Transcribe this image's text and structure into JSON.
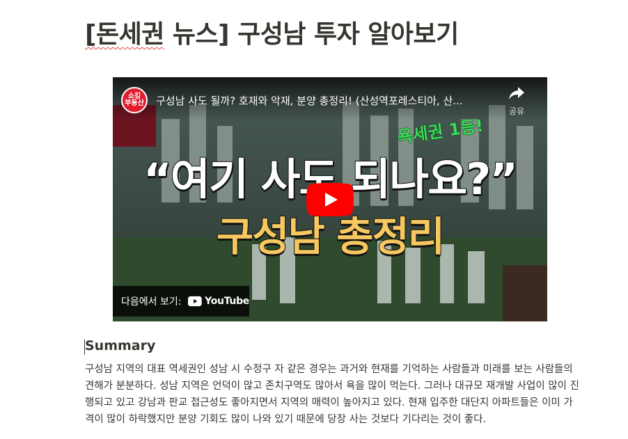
{
  "page": {
    "title": "[돈세권 뉴스] 구성남 투자 알아보기",
    "title_prefix": "[돈세권",
    "title_rest": " 뉴스] 구성남 투자 알아보기"
  },
  "video": {
    "channel_logo_text": "쇼킹\n부동산",
    "title": "구성남 사도 될까? 호재와 악재, 분양 총정리! (산성역포레스티아, 산...",
    "share_label": "공유",
    "thumbnail_badge": "욕세권 1등!",
    "thumbnail_headline": "“여기 사도 되나요?”",
    "thumbnail_subhead": "구성남 총정리",
    "watch_on_label": "다음에서 보기:",
    "youtube_label": "YouTube"
  },
  "summary": {
    "heading": "Summary",
    "body": "구성남 지역의 대표 역세권인 성남 시 수정구 자 같은 경우는 과거와 현재를 기억하는 사람들과 미래를 보는 사람들의 견해가 분분하다. 성남 지역은 언덕이 많고 존치구역도 많아서 욕을 많이 먹는다. 그러나 대규모 재개발 사업이 많이 진행되고 있고 강남과 판교 접근성도 좋아지면서 지역의 매력이 높아지고 있다. 현재 입주한 대단지 아파트들은 이미 가격이 많이 하락했지만 분양 기회도 많이 나와 있기 때문에 당장 사는 것보다 기다리는 것이 좋다."
  },
  "colors": {
    "text": "#37352f",
    "youtube_red": "#ff0000",
    "headline_yellow": "#f6c85f",
    "badge_green": "#3ddb5a",
    "spellcheck_red": "#e03e3e"
  }
}
